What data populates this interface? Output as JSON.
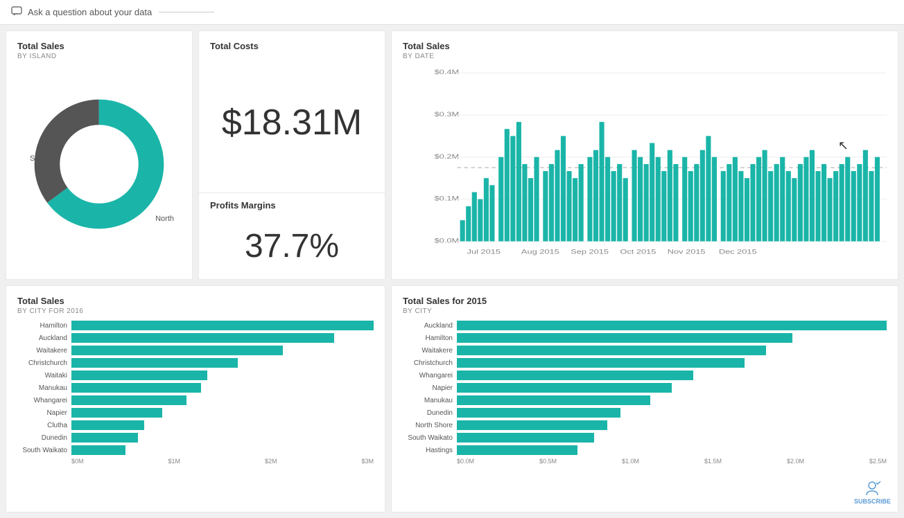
{
  "topbar": {
    "ask_label": "Ask a question about your data",
    "icon": "chat-icon"
  },
  "cards": {
    "total_sales_island": {
      "title": "Total Sales",
      "subtitle": "BY ISLAND",
      "donut": {
        "south_label": "South",
        "north_label": "North",
        "south_pct": 35,
        "north_pct": 65,
        "south_color": "#555",
        "north_color": "#1ab5a8"
      }
    },
    "total_costs": {
      "title": "Total Costs",
      "value": "$18.31M"
    },
    "profits_margins": {
      "title": "Profits Margins",
      "value": "37.7%"
    },
    "total_sales_date": {
      "title": "Total Sales",
      "subtitle": "BY DATE",
      "y_labels": [
        "$0.4M",
        "$0.3M",
        "$0.2M",
        "$0.1M",
        "$0.0M"
      ],
      "x_labels": [
        "Jul 2015",
        "Aug 2015",
        "Sep 2015",
        "Oct 2015",
        "Nov 2015",
        "Dec 2015"
      ],
      "dashed_line_pct": 45,
      "bar_color": "#1ab5a8"
    },
    "total_sales_city_2016": {
      "title": "Total Sales",
      "subtitle": "BY CITY FOR 2016",
      "cities": [
        {
          "name": "Hamilton",
          "value": 100
        },
        {
          "name": "Auckland",
          "value": 87
        },
        {
          "name": "Waitakere",
          "value": 70
        },
        {
          "name": "Christchurch",
          "value": 55
        },
        {
          "name": "Waitaki",
          "value": 45
        },
        {
          "name": "Manukau",
          "value": 43
        },
        {
          "name": "Whangarei",
          "value": 38
        },
        {
          "name": "Napier",
          "value": 30
        },
        {
          "name": "Clutha",
          "value": 24
        },
        {
          "name": "Dunedin",
          "value": 22
        },
        {
          "name": "South Waikato",
          "value": 18
        }
      ],
      "x_labels": [
        "$0M",
        "$1M",
        "$2M",
        "$3M"
      ]
    },
    "total_sales_city_2015": {
      "title": "Total Sales for 2015",
      "subtitle": "BY CITY",
      "cities": [
        {
          "name": "Auckland",
          "value": 100
        },
        {
          "name": "Hamilton",
          "value": 78
        },
        {
          "name": "Waitakere",
          "value": 72
        },
        {
          "name": "Christchurch",
          "value": 67
        },
        {
          "name": "Whangarei",
          "value": 55
        },
        {
          "name": "Napier",
          "value": 50
        },
        {
          "name": "Manukau",
          "value": 45
        },
        {
          "name": "Dunedin",
          "value": 38
        },
        {
          "name": "North Shore",
          "value": 35
        },
        {
          "name": "South Waikato",
          "value": 32
        },
        {
          "name": "Hastings",
          "value": 28
        }
      ],
      "x_labels": [
        "$0.0M",
        "$0.5M",
        "$1.0M",
        "$1.5M",
        "$2.0M",
        "$2.5M"
      ]
    }
  },
  "subscribe": {
    "label": "SUBSCRIBE"
  }
}
